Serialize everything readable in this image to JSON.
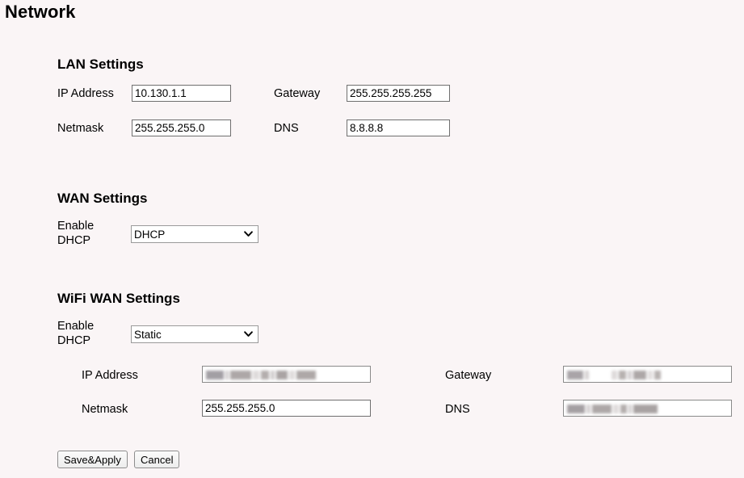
{
  "page": {
    "title": "Network",
    "background_color": "#faf5f6"
  },
  "lan": {
    "heading": "LAN Settings",
    "ip_address_label": "IP Address",
    "ip_address_value": "10.130.1.1",
    "netmask_label": "Netmask",
    "netmask_value": "255.255.255.0",
    "gateway_label": "Gateway",
    "gateway_value": "255.255.255.255",
    "dns_label": "DNS",
    "dns_value": "8.8.8.8"
  },
  "wan": {
    "heading": "WAN Settings",
    "enable_dhcp_label": "Enable\nDHCP",
    "enable_dhcp_value": "DHCP",
    "enable_dhcp_options": [
      "DHCP",
      "Static"
    ]
  },
  "wifi_wan": {
    "heading": "WiFi WAN Settings",
    "enable_dhcp_label": "Enable\nDHCP",
    "enable_dhcp_value": "Static",
    "enable_dhcp_options": [
      "DHCP",
      "Static"
    ],
    "ip_address_label": "IP Address",
    "ip_address_value": "",
    "ip_address_redacted": true,
    "netmask_label": "Netmask",
    "netmask_value": "255.255.255.0",
    "gateway_label": "Gateway",
    "gateway_value": "",
    "gateway_redacted": true,
    "dns_label": "DNS",
    "dns_value": "",
    "dns_redacted": true
  },
  "actions": {
    "save_label": "Save&Apply",
    "cancel_label": "Cancel"
  }
}
